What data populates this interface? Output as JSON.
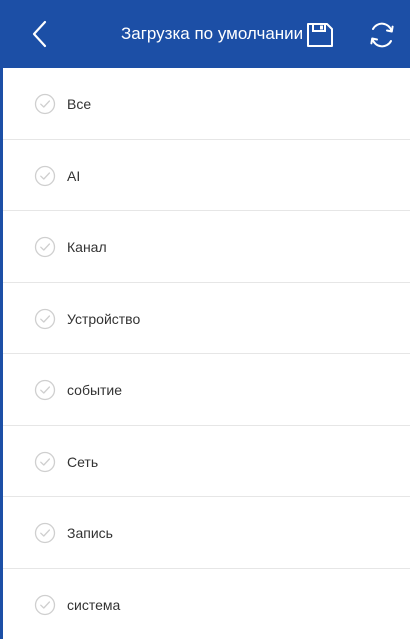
{
  "header": {
    "title": "Загрузка по умолчании",
    "back_icon": "chevron-left-icon",
    "save_icon": "save-icon",
    "refresh_icon": "refresh-icon",
    "background_color": "#1c4fa6"
  },
  "list": {
    "items": [
      {
        "label": "Все",
        "checked": false
      },
      {
        "label": "AI",
        "checked": false
      },
      {
        "label": "Канал",
        "checked": false
      },
      {
        "label": "Устройство",
        "checked": false
      },
      {
        "label": "событие",
        "checked": false
      },
      {
        "label": "Сеть",
        "checked": false
      },
      {
        "label": "Запись",
        "checked": false
      },
      {
        "label": "система",
        "checked": false
      }
    ],
    "check_icon": "check-circle-icon"
  }
}
